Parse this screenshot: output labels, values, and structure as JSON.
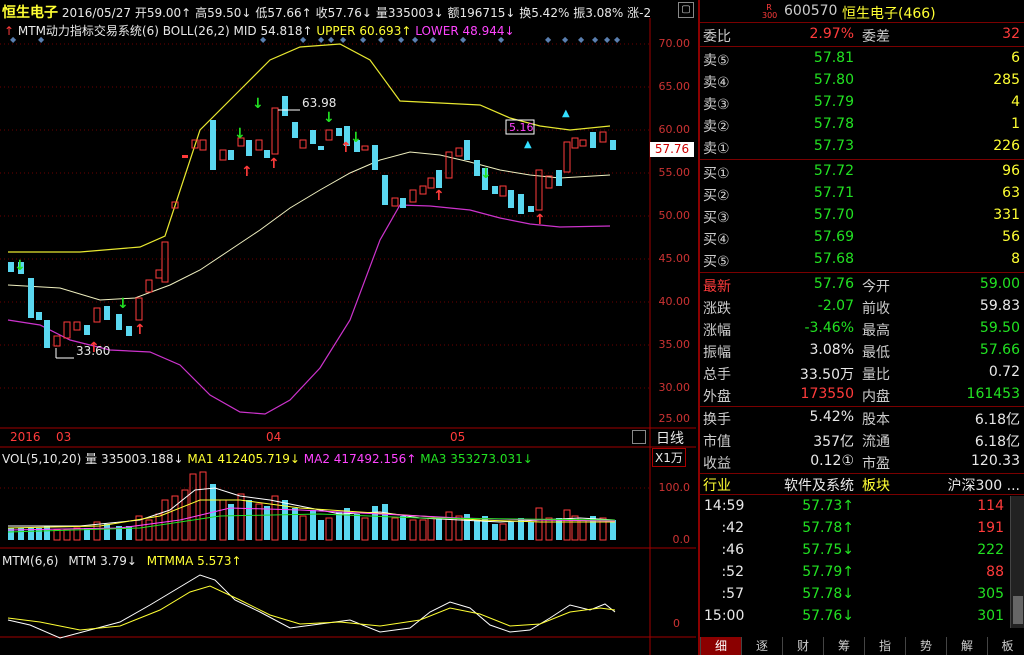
{
  "header": {
    "name": "恒生电子",
    "date": "2016/05/27",
    "open": "开59.00↑",
    "high": "高59.50↓",
    "low": "低57.66↑",
    "close": "收57.76↓",
    "volume": "量335003↓",
    "amount": "额196715↓",
    "turnover": "换5.42%",
    "amplitude": "振3.08%",
    "change": "涨-2"
  },
  "indicator_line": {
    "title": "MTM动力指标交易系统(6)",
    "boll": "BOLL(26,2)",
    "mid": "MID 54.818↑",
    "upper": "UPPER 60.693↑",
    "lower": "LOWER 48.944↓"
  },
  "price_axis": [
    "70.00",
    "65.00",
    "60.00",
    "55.00",
    "50.00",
    "45.00",
    "40.00",
    "35.00",
    "30.00",
    "25.00"
  ],
  "current_price_tag": "57.76",
  "annotations": {
    "high_label": "63.98",
    "low_label": "33.60",
    "box_label": "5.16"
  },
  "date_axis": {
    "year": "2016",
    "m1": "03",
    "m2": "04",
    "m3": "05",
    "period": "日线",
    "unit": "X1万"
  },
  "vol_header": {
    "label": "VOL(5,10,20)",
    "vol": "量 335003.188↓",
    "ma1": "MA1 412405.719↓",
    "ma2": "MA2 417492.156↑",
    "ma3": "MA3 353273.031↓"
  },
  "vol_axis": [
    "100.0",
    "0.0"
  ],
  "mtm_header": {
    "label": "MTM(6,6)",
    "mtm": "MTM 3.79↓",
    "mtmma": "MTMMA 5.573↑"
  },
  "mtm_axis": [
    "0"
  ],
  "quote": {
    "code_prefix": "R 300",
    "code": "600570",
    "name": "恒生电子(466)",
    "weibi_label": "委比",
    "weibi": "2.97%",
    "weicha_label": "委差",
    "weicha": "32",
    "sells": [
      {
        "label": "卖⑤",
        "price": "57.81",
        "vol": "6"
      },
      {
        "label": "卖④",
        "price": "57.80",
        "vol": "285"
      },
      {
        "label": "卖③",
        "price": "57.79",
        "vol": "4"
      },
      {
        "label": "卖②",
        "price": "57.78",
        "vol": "1"
      },
      {
        "label": "卖①",
        "price": "57.73",
        "vol": "226"
      }
    ],
    "buys": [
      {
        "label": "买①",
        "price": "57.72",
        "vol": "96"
      },
      {
        "label": "买②",
        "price": "57.71",
        "vol": "63"
      },
      {
        "label": "买③",
        "price": "57.70",
        "vol": "331"
      },
      {
        "label": "买④",
        "price": "57.69",
        "vol": "56"
      },
      {
        "label": "买⑤",
        "price": "57.68",
        "vol": "8"
      }
    ],
    "stats": [
      {
        "l1": "最新",
        "v1": "57.76",
        "l2": "今开",
        "v2": "59.00"
      },
      {
        "l1": "涨跌",
        "v1": "-2.07",
        "l2": "前收",
        "v2": "59.83"
      },
      {
        "l1": "涨幅",
        "v1": "-3.46%",
        "l2": "最高",
        "v2": "59.50"
      },
      {
        "l1": "振幅",
        "v1": "3.08%",
        "l2": "最低",
        "v2": "57.66"
      },
      {
        "l1": "总手",
        "v1": "33.50万",
        "l2": "量比",
        "v2": "0.72"
      },
      {
        "l1": "外盘",
        "v1": "173550",
        "l2": "内盘",
        "v2": "161453"
      }
    ],
    "stats2": [
      {
        "l1": "换手",
        "v1": "5.42%",
        "l2": "股本",
        "v2": "6.18亿"
      },
      {
        "l1": "市值",
        "v1": "357亿",
        "l2": "流通",
        "v2": "6.18亿"
      },
      {
        "l1": "收益",
        "v1": "0.12①",
        "l2": "市盈",
        "v2": "120.33"
      }
    ],
    "industry": {
      "l1": "行业",
      "v1": "软件及系统",
      "l2": "板块",
      "v2": "沪深300 ..."
    },
    "ticks": [
      {
        "time": "14:59",
        "price": "57.73↑",
        "vol": "114"
      },
      {
        "time": ":42",
        "price": "57.78↑",
        "vol": "191"
      },
      {
        "time": ":46",
        "price": "57.75↓",
        "vol": "222"
      },
      {
        "time": ":52",
        "price": "57.79↑",
        "vol": "88"
      },
      {
        "time": ":57",
        "price": "57.78↓",
        "vol": "305"
      },
      {
        "time": "15:00",
        "price": "57.76↓",
        "vol": "301"
      }
    ],
    "tabs": [
      "细",
      "逐",
      "财",
      "筹",
      "指",
      "势",
      "解",
      "板"
    ]
  }
}
